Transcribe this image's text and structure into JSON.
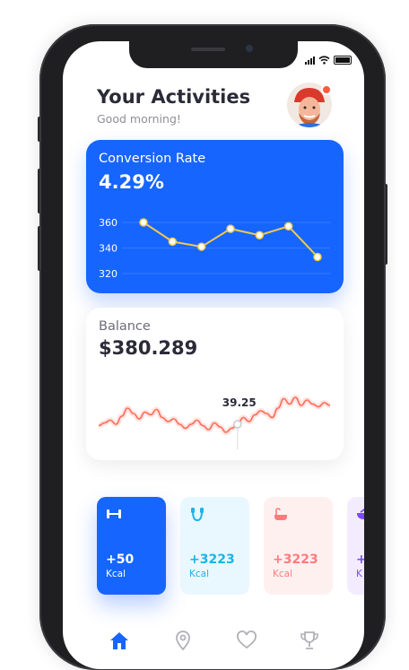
{
  "status": {
    "icons": [
      "signal-icon",
      "wifi-icon",
      "battery-icon"
    ]
  },
  "header": {
    "title": "Your Activities",
    "greeting": "Good morning!"
  },
  "conversion": {
    "label": "Conversion Rate",
    "value": "4.29%",
    "accent": "#1765ff",
    "line_color": "#f2c84b",
    "chart_data": {
      "type": "line",
      "y_ticks": [
        "360",
        "340",
        "320"
      ],
      "ylim": [
        320,
        360
      ],
      "values": [
        360,
        345,
        341,
        355,
        350,
        357,
        333
      ]
    }
  },
  "balance": {
    "label": "Balance",
    "value": "$380.289",
    "marker_label": "39.25",
    "line_color": "#ff6b57",
    "chart_data": {
      "type": "line",
      "values": [
        18,
        22,
        26,
        20,
        32,
        44,
        36,
        28,
        38,
        34,
        42,
        30,
        24,
        28,
        20,
        14,
        20,
        26,
        18,
        12,
        22,
        16,
        8,
        14,
        20,
        30,
        24,
        34,
        40,
        36,
        30,
        44,
        58,
        50,
        60,
        48,
        56,
        50,
        46,
        52,
        48
      ],
      "marker_index": 24
    }
  },
  "activities": [
    {
      "icon": "dumbbell-icon",
      "value": "+50",
      "unit": "Kcal",
      "bg": "#1765ff",
      "fg": "#ffffff"
    },
    {
      "icon": "jump-rope-icon",
      "value": "+3223",
      "unit": "Kcal",
      "bg": "#e9f7ff",
      "fg": "#18b5e8"
    },
    {
      "icon": "bathtub-icon",
      "value": "+3223",
      "unit": "Kcal",
      "bg": "#fff0f0",
      "fg": "#ff7b7b"
    },
    {
      "icon": "bowl-icon",
      "value": "+",
      "unit": "K",
      "bg": "#f3ecff",
      "fg": "#7b4cff"
    }
  ],
  "nav": [
    "home-icon",
    "location-icon",
    "heart-icon",
    "trophy-icon"
  ]
}
